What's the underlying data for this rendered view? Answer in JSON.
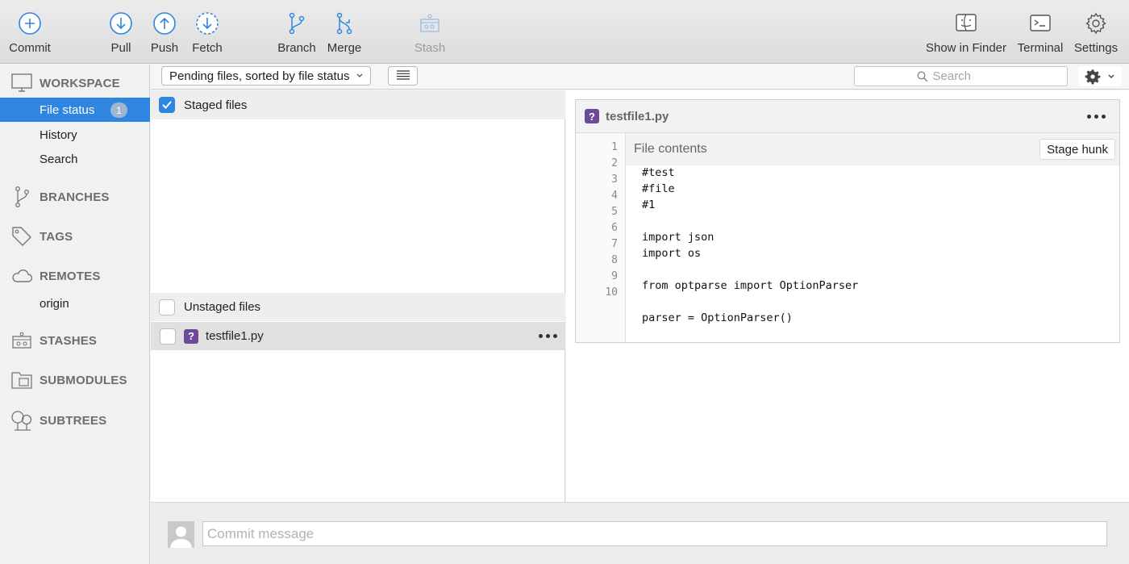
{
  "toolbar": {
    "commit": {
      "label": "Commit",
      "icon": "plus-circle-icon"
    },
    "pull": {
      "label": "Pull",
      "icon": "arrow-down-circle-icon"
    },
    "push": {
      "label": "Push",
      "icon": "arrow-up-circle-icon"
    },
    "fetch": {
      "label": "Fetch",
      "icon": "dashed-arrow-down-circle-icon"
    },
    "branch": {
      "label": "Branch",
      "icon": "branch-icon"
    },
    "merge": {
      "label": "Merge",
      "icon": "merge-icon"
    },
    "stash": {
      "label": "Stash",
      "icon": "stash-icon",
      "disabled": true
    },
    "show_in_finder": {
      "label": "Show in Finder",
      "icon": "finder-icon"
    },
    "terminal": {
      "label": "Terminal",
      "icon": "terminal-icon"
    },
    "settings": {
      "label": "Settings",
      "icon": "gear-icon"
    }
  },
  "sidebar": {
    "workspace": {
      "title": "WORKSPACE",
      "items": [
        {
          "label": "File status",
          "badge": "1",
          "active": true
        },
        {
          "label": "History"
        },
        {
          "label": "Search"
        }
      ]
    },
    "branches": {
      "title": "BRANCHES"
    },
    "tags": {
      "title": "TAGS"
    },
    "remotes": {
      "title": "REMOTES",
      "items": [
        {
          "label": "origin"
        }
      ]
    },
    "stashes": {
      "title": "STASHES"
    },
    "submodules": {
      "title": "SUBMODULES"
    },
    "subtrees": {
      "title": "SUBTREES"
    }
  },
  "subbar": {
    "sort_label": "Pending files, sorted by file status",
    "search_placeholder": "Search"
  },
  "files": {
    "staged": {
      "label": "Staged files",
      "checked": true
    },
    "unstaged": {
      "label": "Unstaged files",
      "checked": false
    },
    "unstaged_files": [
      {
        "name": "testfile1.py",
        "status": "?"
      }
    ]
  },
  "diff": {
    "file_name": "testfile1.py",
    "status": "?",
    "hunk_label": "File contents",
    "stage_hunk_label": "Stage hunk",
    "lines": [
      {
        "n": "1",
        "text": "#test"
      },
      {
        "n": "2",
        "text": "#file"
      },
      {
        "n": "3",
        "text": "#1"
      },
      {
        "n": "4",
        "text": ""
      },
      {
        "n": "5",
        "text": "import json"
      },
      {
        "n": "6",
        "text": "import os"
      },
      {
        "n": "7",
        "text": ""
      },
      {
        "n": "8",
        "text": "from optparse import OptionParser"
      },
      {
        "n": "9",
        "text": ""
      },
      {
        "n": "10",
        "text": "parser = OptionParser()"
      }
    ]
  },
  "commit": {
    "message_placeholder": "Commit message"
  },
  "colors": {
    "accent": "#2f86e0",
    "untracked_badge": "#6b4a9a",
    "toolbar_icon": "#2f86e0"
  }
}
